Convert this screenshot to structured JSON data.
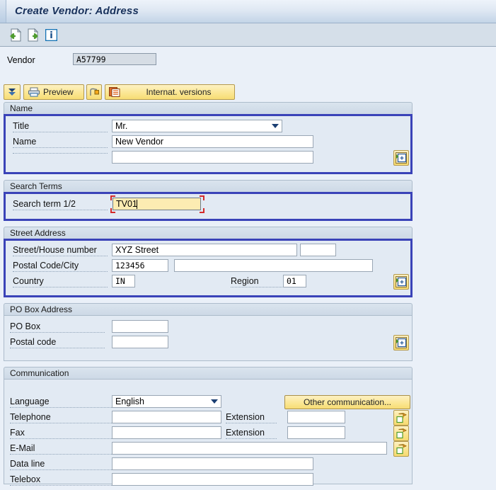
{
  "window": {
    "title": "Create Vendor: Address"
  },
  "icon_toolbar": [
    {
      "name": "previous-document-icon",
      "tooltip": "Back"
    },
    {
      "name": "next-document-icon",
      "tooltip": "Forward"
    },
    {
      "name": "info-icon",
      "tooltip": "Information"
    }
  ],
  "vendor": {
    "label": "Vendor",
    "value": "A57799"
  },
  "function_toolbar": {
    "expand_label": "",
    "preview_label": "Preview",
    "lock_label": "",
    "international_label": "Internat. versions"
  },
  "sections": {
    "name": {
      "title": "Name",
      "title_label": "Title",
      "title_value": "Mr.",
      "name_label": "Name",
      "name_value": "New Vendor",
      "name_value_2": "",
      "detail_button": "address-detail-icon"
    },
    "search_terms": {
      "title": "Search Terms",
      "search_term_label": "Search term 1/2",
      "search_term_value": "TV01"
    },
    "street_address": {
      "title": "Street Address",
      "street_label": "Street/House number",
      "street_value": "XYZ Street",
      "house_number_value": "",
      "postal_city_label": "Postal Code/City",
      "postal_code_value": "123456",
      "city_value": "",
      "country_label": "Country",
      "country_value": "IN",
      "region_label": "Region",
      "region_value": "01",
      "detail_button": "address-detail-icon"
    },
    "po_box_address": {
      "title": "PO Box Address",
      "po_box_label": "PO Box",
      "po_box_value": "",
      "postal_code_label": "Postal code",
      "postal_code_value": "",
      "detail_button": "address-detail-icon"
    },
    "communication": {
      "title": "Communication",
      "language_label": "Language",
      "language_value": "English",
      "other_communication_label": "Other communication...",
      "telephone_label": "Telephone",
      "telephone_value": "",
      "telephone_ext_label": "Extension",
      "telephone_ext_value": "",
      "fax_label": "Fax",
      "fax_value": "",
      "fax_ext_label": "Extension",
      "fax_ext_value": "",
      "email_label": "E-Mail",
      "email_value": "",
      "data_line_label": "Data line",
      "data_line_value": "",
      "telebox_label": "Telebox",
      "telebox_value": ""
    }
  },
  "colors": {
    "title_text": "#19325c",
    "focus_frame": "#3a43b8",
    "focus_field_bg": "#fcecb2",
    "focus_bracket": "#d42b2b",
    "button_yellow": "#fbe795",
    "panel_bg": "#e2eaf3"
  }
}
